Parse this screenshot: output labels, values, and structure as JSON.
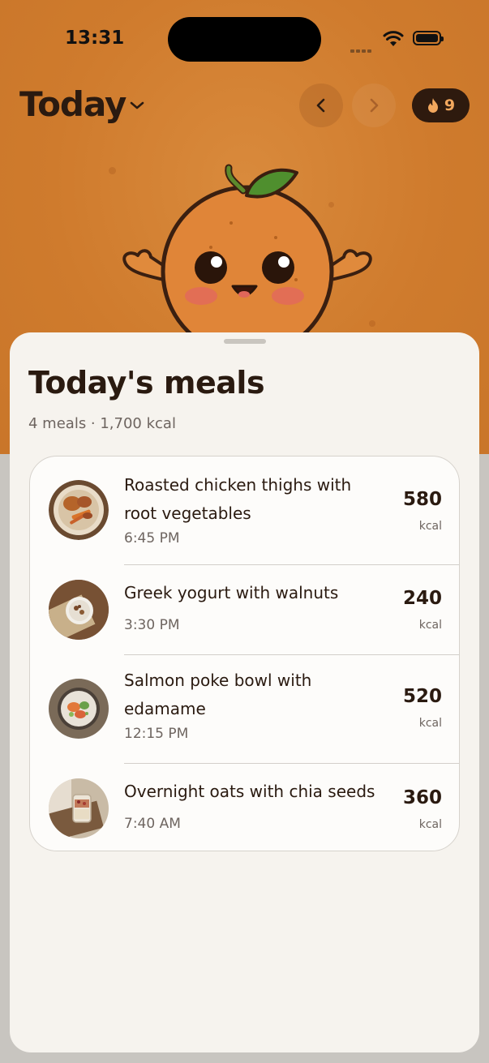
{
  "status_bar": {
    "time": "13:31"
  },
  "header": {
    "title": "Today",
    "streak_count": "9"
  },
  "sheet": {
    "title": "Today's meals",
    "subtitle": "4 meals · 1,700 kcal"
  },
  "meals": [
    {
      "name_line1": "Roasted chicken thighs with",
      "name_line2": "root vegetables",
      "time": "6:45 PM",
      "kcal": "580",
      "unit": "kcal"
    },
    {
      "name_line1": "Greek yogurt with walnuts",
      "name_line2": "",
      "time": "3:30 PM",
      "kcal": "240",
      "unit": "kcal"
    },
    {
      "name_line1": "Salmon poke bowl with",
      "name_line2": "edamame",
      "time": "12:15 PM",
      "kcal": "520",
      "unit": "kcal"
    },
    {
      "name_line1": "Overnight oats with chia seeds",
      "name_line2": "",
      "time": "7:40 AM",
      "kcal": "360",
      "unit": "kcal"
    }
  ],
  "colors": {
    "hero_orange": "#cf7b2d",
    "text_dark": "#2a1a10",
    "sheet_bg": "#f6f3ee",
    "streak_bg": "#2e1a0e",
    "streak_accent": "#f3a85e"
  }
}
